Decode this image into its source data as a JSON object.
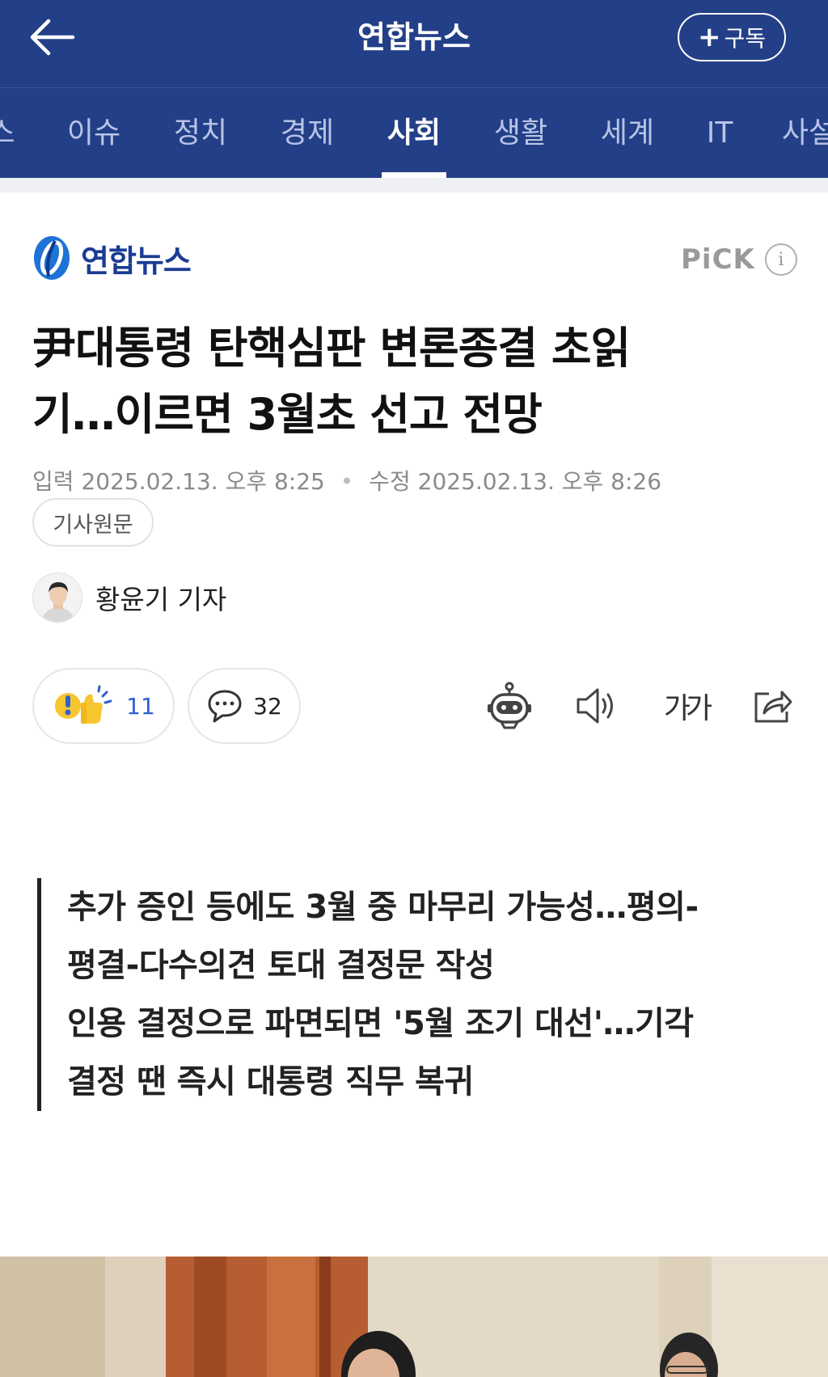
{
  "header": {
    "title": "연합뉴스",
    "subscribe_label": "구독"
  },
  "tabs": [
    {
      "label": "스",
      "active": false
    },
    {
      "label": "이슈",
      "active": false
    },
    {
      "label": "정치",
      "active": false
    },
    {
      "label": "경제",
      "active": false
    },
    {
      "label": "사회",
      "active": true
    },
    {
      "label": "생활",
      "active": false
    },
    {
      "label": "세계",
      "active": false
    },
    {
      "label": "IT",
      "active": false
    },
    {
      "label": "사설",
      "active": false
    }
  ],
  "press": {
    "name": "연합뉴스",
    "pick_label": "PiCK",
    "info_label": "i"
  },
  "article": {
    "headline_line1": "尹대통령 탄핵심판 변론종결 초읽",
    "headline_line2": "기…이르면 3월초 선고 전망",
    "input_label": "입력",
    "input_date": "2025.02.13. 오후 8:25",
    "modified_label": "수정",
    "modified_date": "2025.02.13. 오후 8:26",
    "original_button": "기사원문",
    "reporter": "황윤기 기자",
    "reaction_count": "11",
    "comment_count": "32",
    "font_size_label": "가가",
    "summary": [
      "추가 증인 등에도 3월 중 마무리 가능성…평의-",
      "평결-다수의견 토대 결정문 작성",
      "인용 결정으로 파면되면 '5월 조기 대선'…기각",
      "결정 땐 즉시 대통령 직무 복귀"
    ]
  },
  "colors": {
    "brand": "#233f87",
    "logo_blue": "#1b3c93",
    "reaction_blue": "#2f5fd0"
  }
}
